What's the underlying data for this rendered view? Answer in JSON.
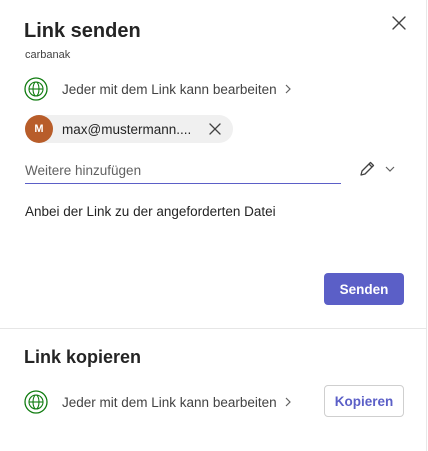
{
  "dialog": {
    "title": "Link senden",
    "subtitle": "carbanak",
    "close_icon": "close-icon"
  },
  "send": {
    "permission_label": "Jeder mit dem Link kann bearbeiten",
    "recipient": {
      "initial": "M",
      "label": "max@mustermann....",
      "avatar_color": "#b85d2a"
    },
    "add_placeholder": "Weitere hinzufügen",
    "message": "Anbei der Link zu der angeforderten Datei",
    "send_label": "Senden"
  },
  "copy": {
    "title": "Link kopieren",
    "permission_label": "Jeder mit dem Link kann bearbeiten",
    "copy_label": "Kopieren"
  },
  "colors": {
    "accent": "#5b5fc7",
    "globe": "#107c10",
    "text": "#242424"
  },
  "icons": [
    "close-icon",
    "globe-icon",
    "chevron-right-icon",
    "remove-icon",
    "pencil-icon",
    "chevron-down-icon"
  ]
}
